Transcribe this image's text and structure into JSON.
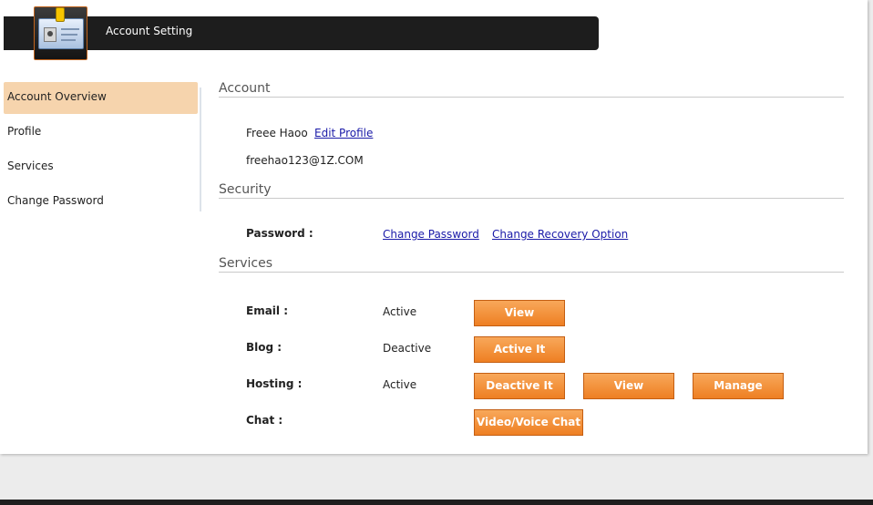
{
  "header": {
    "title": "Account Setting",
    "icon": "id-card-icon"
  },
  "sidebar": {
    "items": [
      {
        "label": "Account Overview"
      },
      {
        "label": "Profile"
      },
      {
        "label": "Services"
      },
      {
        "label": "Change Password"
      }
    ]
  },
  "account": {
    "section_title": "Account",
    "name": "Freee Haoo",
    "edit_profile_label": "Edit Profile",
    "email": "freehao123@1Z.COM"
  },
  "security": {
    "section_title": "Security",
    "password_label": "Password :",
    "change_password_label": "Change Password",
    "change_recovery_label": "Change Recovery Option"
  },
  "services": {
    "section_title": "Services",
    "rows": [
      {
        "label": "Email :",
        "status": "Active",
        "buttons": [
          "View"
        ]
      },
      {
        "label": "Blog :",
        "status": "Deactive",
        "buttons": [
          "Active It"
        ]
      },
      {
        "label": "Hosting :",
        "status": "Active",
        "buttons": [
          "Deactive It",
          "View",
          "Manage"
        ]
      },
      {
        "label": "Chat :",
        "status": "",
        "buttons": [
          "Video/Voice Chat"
        ]
      }
    ]
  },
  "colors": {
    "accent": "#ee7f23",
    "sidebar_active": "#f6d4ad",
    "header_bg": "#1d1d1d",
    "link": "#1a1aa8"
  }
}
